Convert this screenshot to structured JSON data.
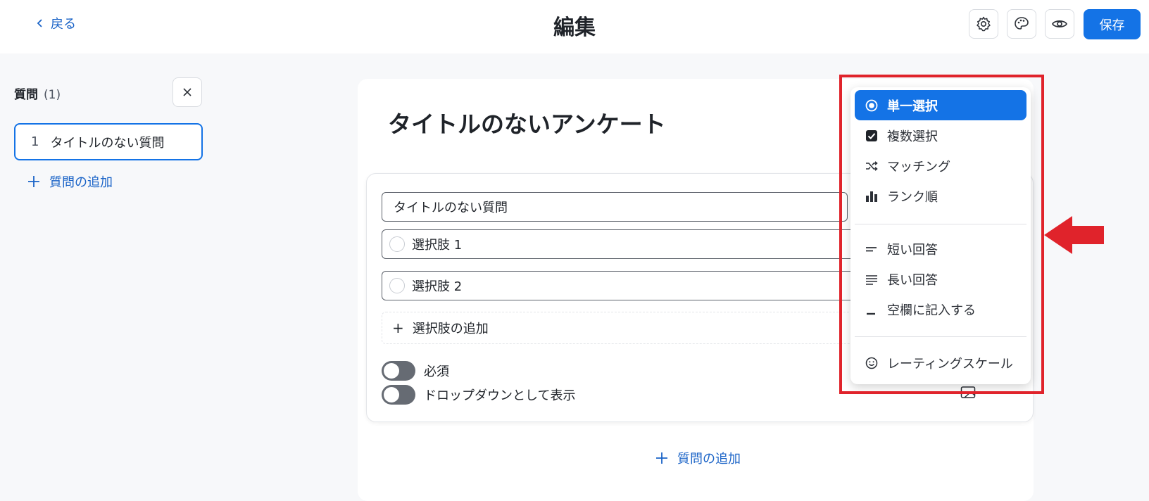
{
  "header": {
    "back_label": "戻る",
    "title": "編集",
    "save_label": "保存"
  },
  "sidebar": {
    "heading": "質問",
    "count": "(1)",
    "items": [
      {
        "number": "1",
        "label": "タイトルのない質問"
      }
    ],
    "add_label": "質問の追加"
  },
  "survey": {
    "title": "タイトルのないアンケート",
    "question": {
      "title_value": "タイトルのない質問",
      "options": [
        "選択肢 1",
        "選択肢 2"
      ],
      "add_option_label": "選択肢の追加",
      "required_label": "必須",
      "dropdown_label": "ドロップダウンとして表示"
    },
    "add_question_label": "質問の追加"
  },
  "type_menu": {
    "groups": [
      [
        {
          "label": "単一選択",
          "icon": "radio-icon",
          "selected": true
        },
        {
          "label": "複数選択",
          "icon": "checkbox-icon",
          "selected": false
        },
        {
          "label": "マッチング",
          "icon": "shuffle-icon",
          "selected": false
        },
        {
          "label": "ランク順",
          "icon": "bar-chart-icon",
          "selected": false
        }
      ],
      [
        {
          "label": "短い回答",
          "icon": "short-answer-icon",
          "selected": false
        },
        {
          "label": "長い回答",
          "icon": "long-answer-icon",
          "selected": false
        },
        {
          "label": "空欄に記入する",
          "icon": "fill-blank-icon",
          "selected": false
        }
      ],
      [
        {
          "label": "レーティングスケール",
          "icon": "smiley-icon",
          "selected": false
        }
      ]
    ]
  },
  "colors": {
    "accent": "#1473e6",
    "annotation": "#e0232b"
  }
}
